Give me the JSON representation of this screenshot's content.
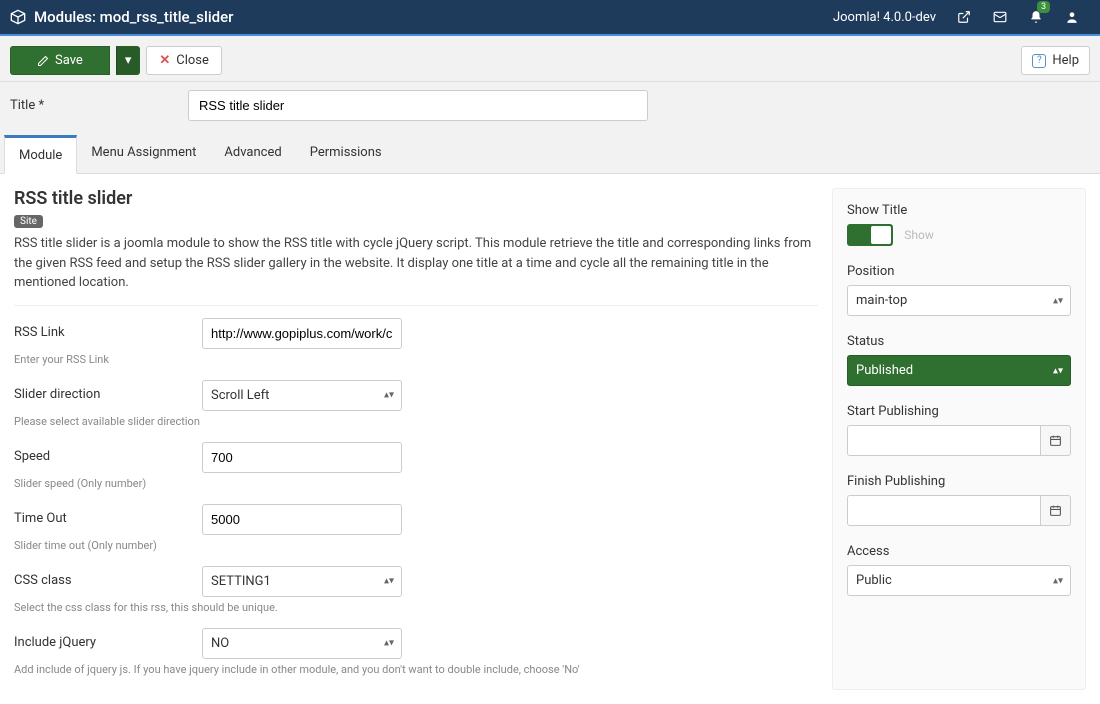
{
  "topnav": {
    "title": "Modules: mod_rss_title_slider",
    "version": "Joomla! 4.0.0-dev",
    "notif_count": "3"
  },
  "toolbar": {
    "save": "Save",
    "close": "Close",
    "help": "Help"
  },
  "title_field": {
    "label": "Title *",
    "value": "RSS title slider"
  },
  "tabs": [
    "Module",
    "Menu Assignment",
    "Advanced",
    "Permissions"
  ],
  "module": {
    "heading": "RSS title slider",
    "badge": "Site",
    "desc": "RSS title slider is a joomla module to show the RSS title with cycle jQuery script. This module retrieve the title and corresponding links from the given RSS feed and setup the RSS slider gallery in the website. It display one title at a time and cycle all the remaining title in the mentioned location.",
    "fields": {
      "rss_link": {
        "label": "RSS Link",
        "value": "http://www.gopiplus.com/work/categ",
        "hint": "Enter your RSS Link"
      },
      "direction": {
        "label": "Slider direction",
        "value": "Scroll Left",
        "hint": "Please select available slider direction"
      },
      "speed": {
        "label": "Speed",
        "value": "700",
        "hint": "Slider speed (Only number)"
      },
      "timeout": {
        "label": "Time Out",
        "value": "5000",
        "hint": "Slider time out (Only number)"
      },
      "css": {
        "label": "CSS class",
        "value": "SETTING1",
        "hint": "Select the css class for this rss, this should be unique."
      },
      "jquery": {
        "label": "Include jQuery",
        "value": "NO",
        "hint": "Add include of jquery js. If you have jquery include in other module, and you don't want to double include, choose 'No'"
      }
    }
  },
  "sidebar": {
    "show_title": {
      "label": "Show Title",
      "state": "Show"
    },
    "position": {
      "label": "Position",
      "value": "main-top"
    },
    "status": {
      "label": "Status",
      "value": "Published"
    },
    "start_pub": {
      "label": "Start Publishing",
      "value": ""
    },
    "finish_pub": {
      "label": "Finish Publishing",
      "value": ""
    },
    "access": {
      "label": "Access",
      "value": "Public"
    }
  }
}
